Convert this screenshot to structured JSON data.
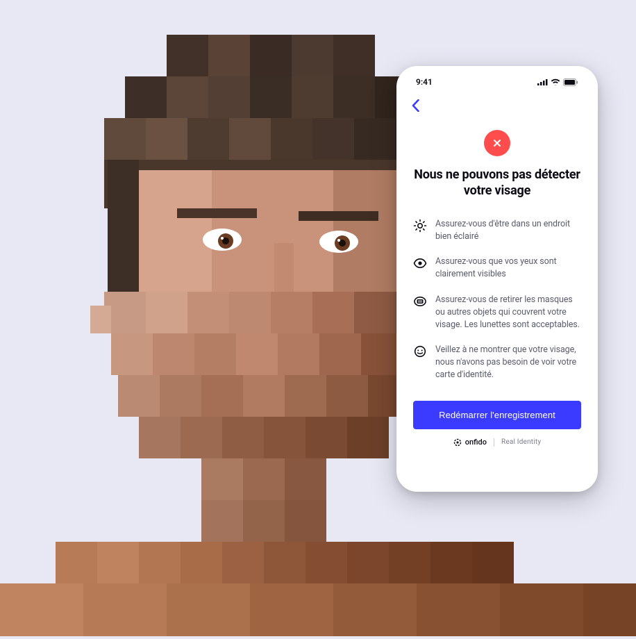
{
  "phone": {
    "status_time": "9:41",
    "title": "Nous ne pouvons pas détecter votre visage",
    "tips": [
      "Assurez-vous d'être dans un endroit bien éclairé",
      "Assurez-vous que vos yeux sont clairement visibles",
      "Assurez-vous de retirer les masques ou autres objets qui couvrent votre visage. Les lunettes sont acceptables.",
      "Veillez à ne montrer que votre visage, nous n'avons pas besoin de voir votre carte d'identité."
    ],
    "cta_label": "Redémarrer l'enregistrement",
    "brand_name": "onfido",
    "brand_tagline": "Real Identity"
  }
}
